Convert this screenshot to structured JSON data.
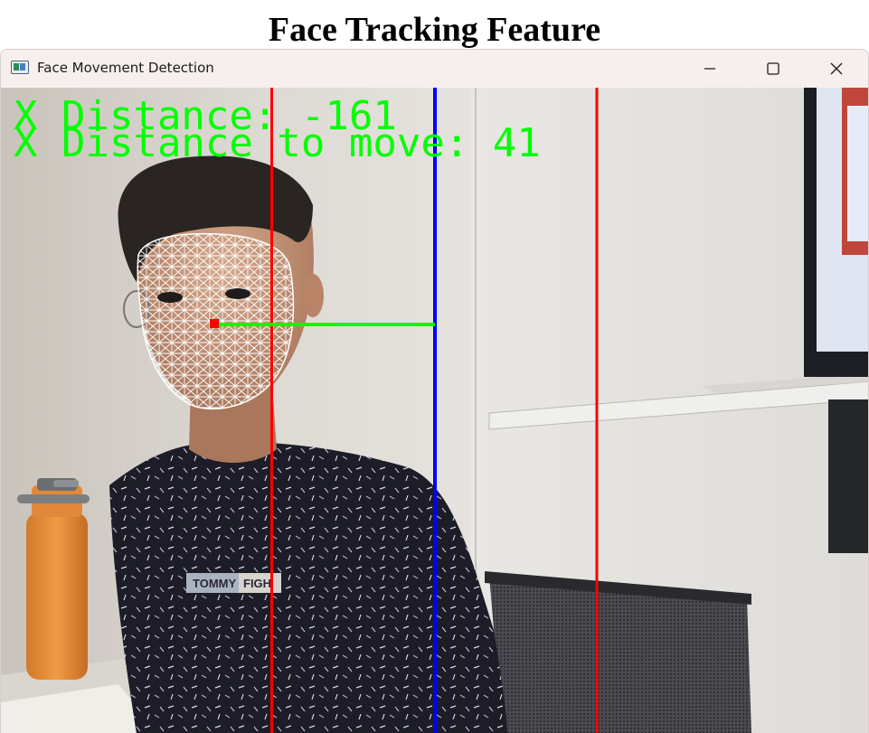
{
  "page": {
    "heading": "Face Tracking Feature"
  },
  "window": {
    "title": "Face Movement Detection",
    "controls": {
      "minimize_icon": "minimize-icon",
      "maximize_icon": "maximize-icon",
      "close_icon": "close-icon"
    }
  },
  "overlay": {
    "x_distance": "X Distance: -161",
    "x_distance_to_move": "X Distance to move: 41",
    "text_color": "#00ff00",
    "line_colors": {
      "boundary": "#ff0000",
      "center": "#0000ff",
      "offset": "#00ff00",
      "nose_marker": "#ff0000",
      "face_mesh": "#ffffff"
    }
  }
}
